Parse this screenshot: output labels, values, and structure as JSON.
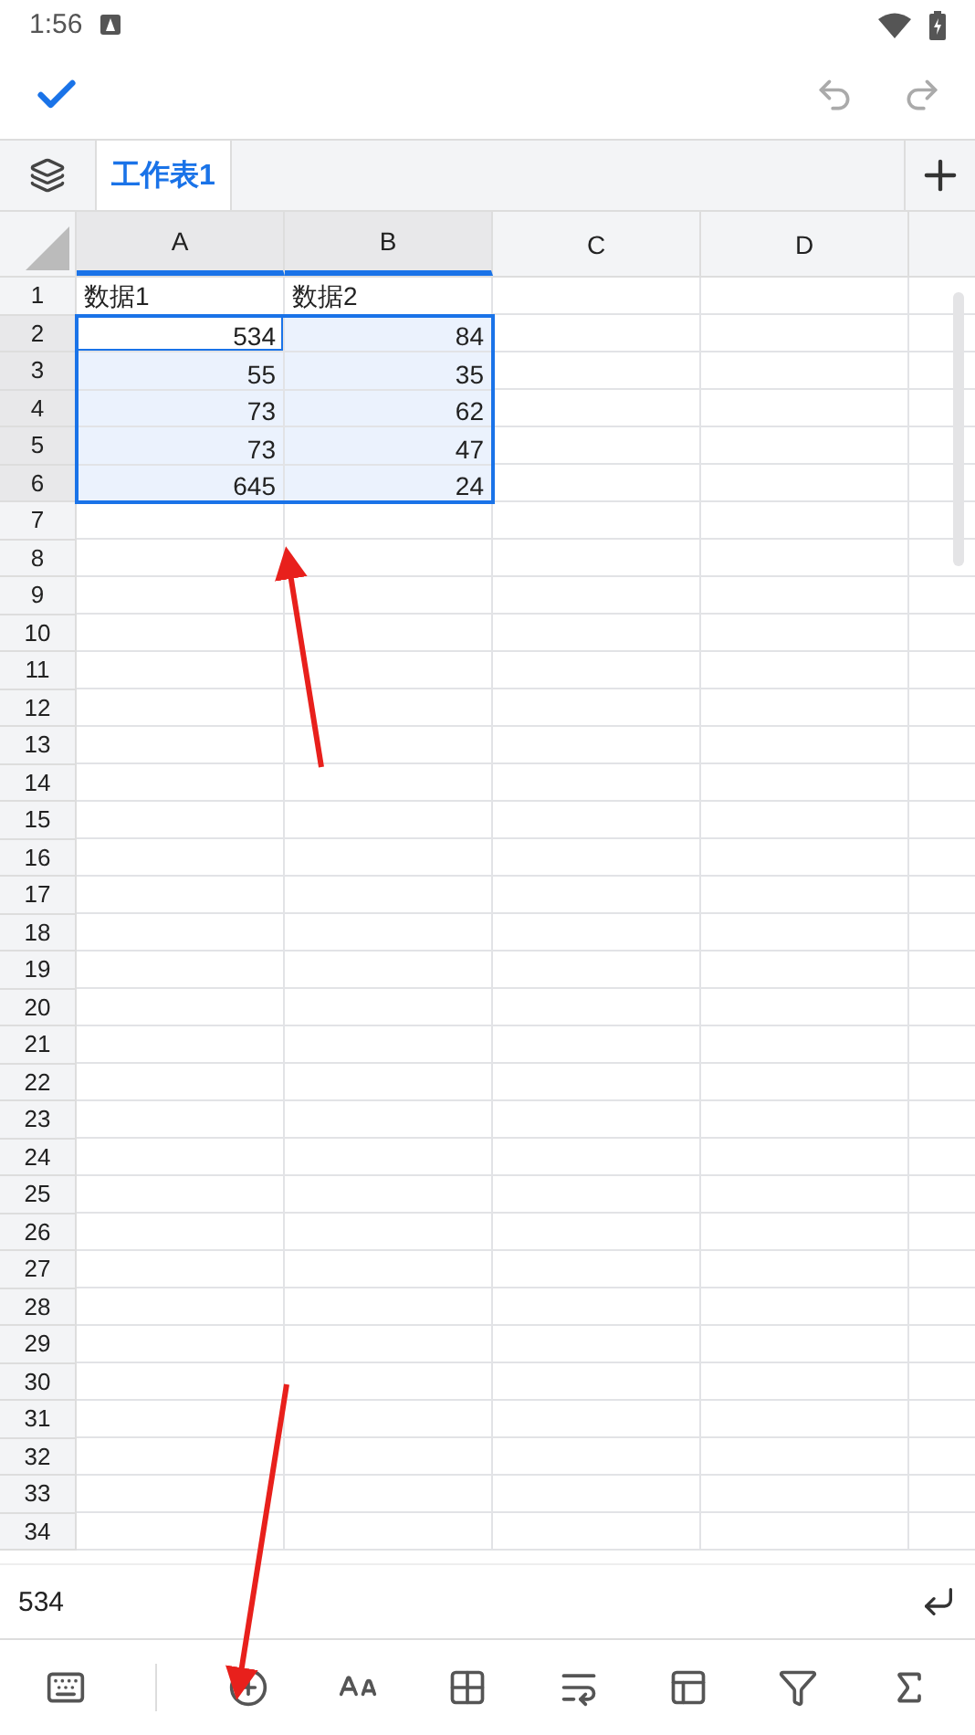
{
  "status_bar": {
    "time": "1:56"
  },
  "sheet_tabs": [
    {
      "label": "工作表1",
      "selected": true
    }
  ],
  "columns": [
    {
      "label": "A",
      "selected": true
    },
    {
      "label": "B",
      "selected": true
    },
    {
      "label": "C",
      "selected": false
    },
    {
      "label": "D",
      "selected": false
    }
  ],
  "rows": [
    {
      "label": "1",
      "selected": false,
      "cells": [
        {
          "text": "数据1",
          "kind": "text",
          "selected": false,
          "active": false
        },
        {
          "text": "数据2",
          "kind": "text",
          "selected": false,
          "active": false
        }
      ]
    },
    {
      "label": "2",
      "selected": true,
      "cells": [
        {
          "text": "534",
          "kind": "number",
          "selected": true,
          "active": true
        },
        {
          "text": "84",
          "kind": "number",
          "selected": true,
          "active": false
        }
      ]
    },
    {
      "label": "3",
      "selected": true,
      "cells": [
        {
          "text": "55",
          "kind": "number",
          "selected": true,
          "active": false
        },
        {
          "text": "35",
          "kind": "number",
          "selected": true,
          "active": false
        }
      ]
    },
    {
      "label": "4",
      "selected": true,
      "cells": [
        {
          "text": "73",
          "kind": "number",
          "selected": true,
          "active": false
        },
        {
          "text": "62",
          "kind": "number",
          "selected": true,
          "active": false
        }
      ]
    },
    {
      "label": "5",
      "selected": true,
      "cells": [
        {
          "text": "73",
          "kind": "number",
          "selected": true,
          "active": false
        },
        {
          "text": "47",
          "kind": "number",
          "selected": true,
          "active": false
        }
      ]
    },
    {
      "label": "6",
      "selected": true,
      "cells": [
        {
          "text": "645",
          "kind": "number",
          "selected": true,
          "active": false
        },
        {
          "text": "24",
          "kind": "number",
          "selected": true,
          "active": false
        }
      ]
    },
    {
      "label": "7",
      "selected": false
    },
    {
      "label": "8",
      "selected": false
    },
    {
      "label": "9",
      "selected": false
    },
    {
      "label": "10",
      "selected": false
    },
    {
      "label": "11",
      "selected": false
    },
    {
      "label": "12",
      "selected": false
    },
    {
      "label": "13",
      "selected": false
    },
    {
      "label": "14",
      "selected": false
    },
    {
      "label": "15",
      "selected": false
    },
    {
      "label": "16",
      "selected": false
    },
    {
      "label": "17",
      "selected": false
    },
    {
      "label": "18",
      "selected": false
    },
    {
      "label": "19",
      "selected": false
    },
    {
      "label": "20",
      "selected": false
    },
    {
      "label": "21",
      "selected": false
    },
    {
      "label": "22",
      "selected": false
    },
    {
      "label": "23",
      "selected": false
    },
    {
      "label": "24",
      "selected": false
    },
    {
      "label": "25",
      "selected": false
    },
    {
      "label": "26",
      "selected": false
    },
    {
      "label": "27",
      "selected": false
    },
    {
      "label": "28",
      "selected": false
    },
    {
      "label": "29",
      "selected": false
    },
    {
      "label": "30",
      "selected": false
    },
    {
      "label": "31",
      "selected": false
    },
    {
      "label": "32",
      "selected": false
    },
    {
      "label": "33",
      "selected": false
    },
    {
      "label": "34",
      "selected": false
    }
  ],
  "formula_bar": {
    "value": "534"
  }
}
